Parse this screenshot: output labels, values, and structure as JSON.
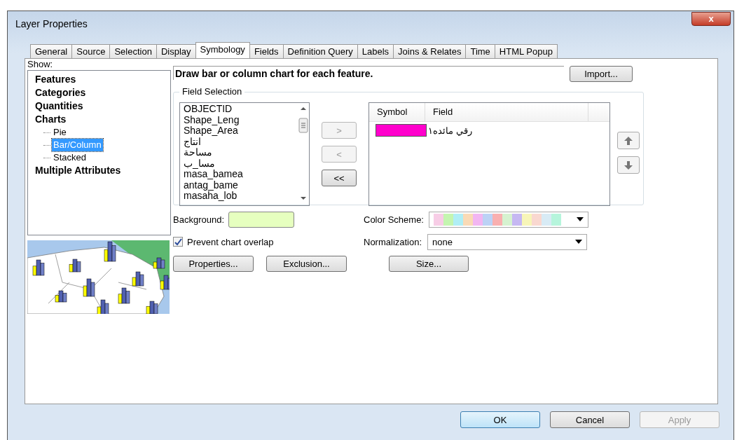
{
  "window": {
    "title": "Layer Properties",
    "close": "x"
  },
  "tabs": [
    {
      "label": "General",
      "selected": false
    },
    {
      "label": "Source",
      "selected": false
    },
    {
      "label": "Selection",
      "selected": false
    },
    {
      "label": "Display",
      "selected": false
    },
    {
      "label": "Symbology",
      "selected": true
    },
    {
      "label": "Fields",
      "selected": false
    },
    {
      "label": "Definition Query",
      "selected": false
    },
    {
      "label": "Labels",
      "selected": false
    },
    {
      "label": "Joins & Relates",
      "selected": false
    },
    {
      "label": "Time",
      "selected": false
    },
    {
      "label": "HTML Popup",
      "selected": false
    }
  ],
  "show": {
    "label": "Show:",
    "items": [
      {
        "label": "Features",
        "selected": false
      },
      {
        "label": "Categories",
        "selected": false
      },
      {
        "label": "Quantities",
        "selected": false
      },
      {
        "label": "Charts",
        "selected": false,
        "children": [
          {
            "label": "Pie",
            "selected": false
          },
          {
            "label": "Bar/Column",
            "selected": true
          },
          {
            "label": "Stacked",
            "selected": false
          }
        ]
      },
      {
        "label": "Multiple Attributes",
        "selected": false
      }
    ]
  },
  "description": "Draw bar or column chart for each feature.",
  "import_button": "Import...",
  "field_selection": {
    "title": "Field Selection",
    "fields": [
      "OBJECTID",
      "Shape_Leng",
      "Shape_Area",
      "انتاج",
      "مساحة",
      "مسا_ب",
      "masa_bamea",
      "antag_bame",
      "masaha_lob"
    ],
    "move_buttons": [
      {
        "label": ">",
        "disabled": true
      },
      {
        "label": "<",
        "disabled": true
      },
      {
        "label": "<<",
        "disabled": false
      }
    ],
    "columns": [
      "Symbol",
      "Field"
    ],
    "rows": [
      {
        "color": "#ff00cc",
        "field": "رقي مائده١"
      }
    ]
  },
  "background": {
    "label": "Background:",
    "color": "#e6ffbf"
  },
  "color_scheme": {
    "label": "Color  Scheme:",
    "colors": [
      {
        "color": "#f7cde6"
      },
      {
        "color": "#c4f5b0"
      },
      {
        "color": "#b0eef5"
      },
      {
        "color": "#f9dab6"
      },
      {
        "color": "#f2b6f2"
      },
      {
        "color": "#bcd2f5"
      },
      {
        "color": "#f9b0b0"
      },
      {
        "color": "#d6f2d0"
      },
      {
        "color": "#c6b8f2"
      },
      {
        "color": "#f7f5b8"
      },
      {
        "color": "#f9d8d0"
      },
      {
        "color": "#d8ebf5"
      },
      {
        "color": "#b6f5dc"
      }
    ]
  },
  "prevent_overlap": {
    "label": "Prevent chart overlap",
    "checked": true
  },
  "normalization": {
    "label": "Normalization:",
    "value": "none"
  },
  "action_buttons": [
    "Properties...",
    "Exclusion...",
    "Size..."
  ],
  "footer_buttons": [
    {
      "label": "OK",
      "disabled": false
    },
    {
      "label": "Cancel",
      "disabled": false
    },
    {
      "label": "Apply",
      "disabled": true
    }
  ]
}
